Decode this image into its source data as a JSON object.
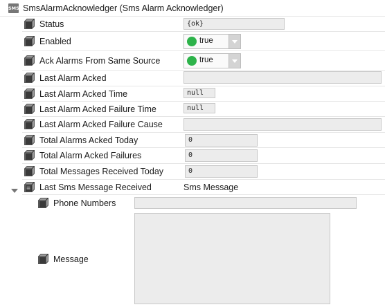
{
  "header": {
    "logo_text": "SMS",
    "title": "SmsAlarmAcknowledger  (Sms Alarm Acknowledger)"
  },
  "properties": {
    "status": {
      "label": "Status",
      "value": "{ok}"
    },
    "enabled": {
      "label": "Enabled",
      "value": "true",
      "indicator_color": "#2db34a"
    },
    "ack_same_src": {
      "label": "Ack Alarms From Same Source",
      "value": "true",
      "indicator_color": "#2db34a"
    },
    "last_acked": {
      "label": "Last Alarm Acked",
      "value": ""
    },
    "last_acked_time": {
      "label": "Last Alarm Acked Time",
      "value": "null"
    },
    "last_fail_time": {
      "label": "Last Alarm Acked Failure Time",
      "value": "null"
    },
    "last_fail_cause": {
      "label": "Last Alarm Acked Failure Cause",
      "value": ""
    },
    "total_today": {
      "label": "Total Alarms Acked Today",
      "value": "0"
    },
    "total_fail": {
      "label": "Total Alarm Acked Failures",
      "value": "0"
    },
    "total_msgs": {
      "label": "Total Messages Received Today",
      "value": "0"
    },
    "last_sms": {
      "label": "Last Sms Message Received",
      "value": "Sms Message"
    },
    "phone_numbers": {
      "label": "Phone Numbers",
      "value": ""
    },
    "message": {
      "label": "Message",
      "value": ""
    }
  }
}
